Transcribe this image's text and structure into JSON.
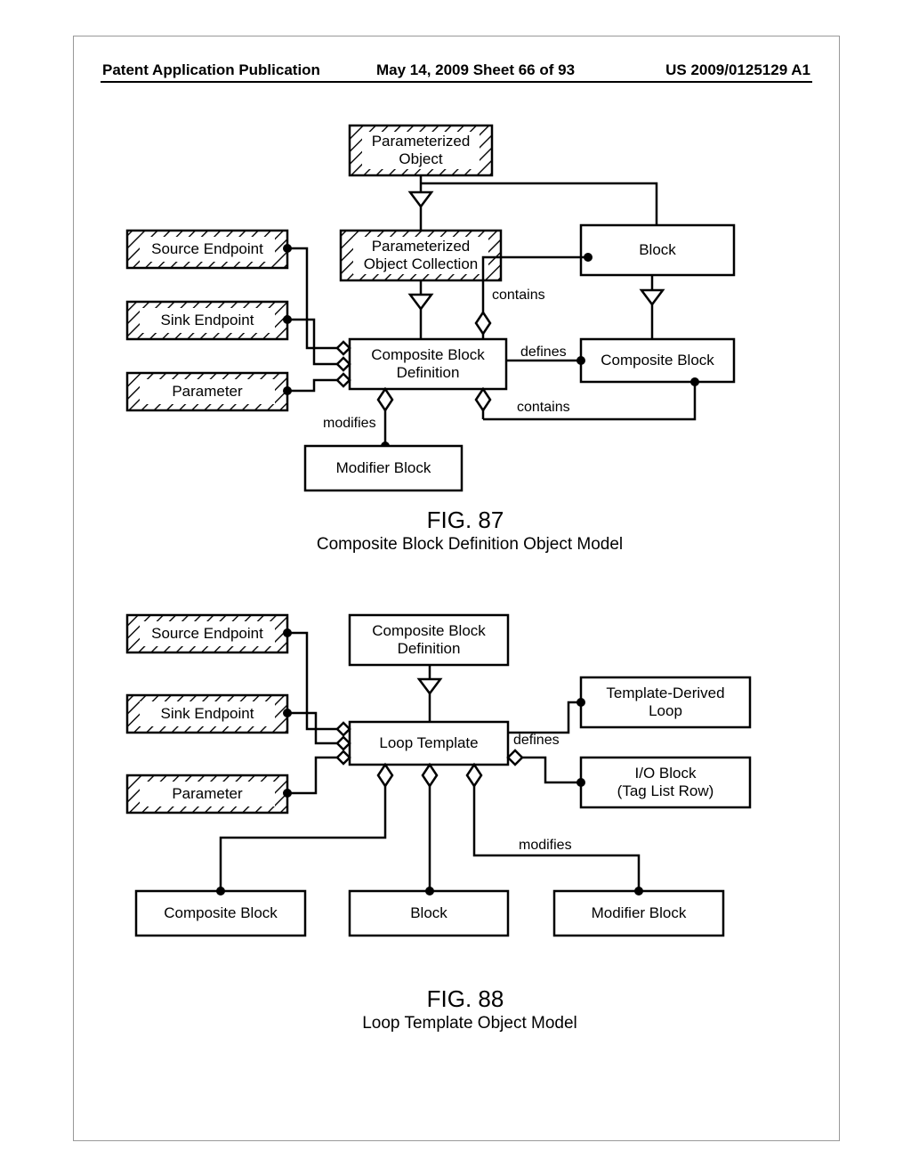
{
  "header": {
    "left": "Patent Application Publication",
    "center": "May 14, 2009  Sheet 66 of 93",
    "right": "US 2009/0125129 A1"
  },
  "fig87": {
    "title_big": "FIG. 87",
    "title_sub": "Composite Block Definition Object Model",
    "boxes": {
      "po": "Parameterized\nObject",
      "poc": "Parameterized\nObject Collection",
      "block": "Block",
      "src": "Source Endpoint",
      "sink": "Sink Endpoint",
      "param": "Parameter",
      "cbd": "Composite Block\nDefinition",
      "cblock": "Composite Block",
      "mod": "Modifier Block"
    },
    "edges": {
      "contains1": "contains",
      "defines": "defines",
      "contains2": "contains",
      "modifies": "modifies"
    }
  },
  "fig88": {
    "title_big": "FIG. 88",
    "title_sub": "Loop Template Object Model",
    "boxes": {
      "cbd": "Composite Block\nDefinition",
      "src": "Source Endpoint",
      "sink": "Sink Endpoint",
      "param": "Parameter",
      "lt": "Loop Template",
      "tdl": "Template-Derived\nLoop",
      "io": "I/O Block\n(Tag List Row)",
      "cblock": "Composite Block",
      "block": "Block",
      "mod": "Modifier Block"
    },
    "edges": {
      "defines": "defines",
      "modifies": "modifies"
    }
  }
}
